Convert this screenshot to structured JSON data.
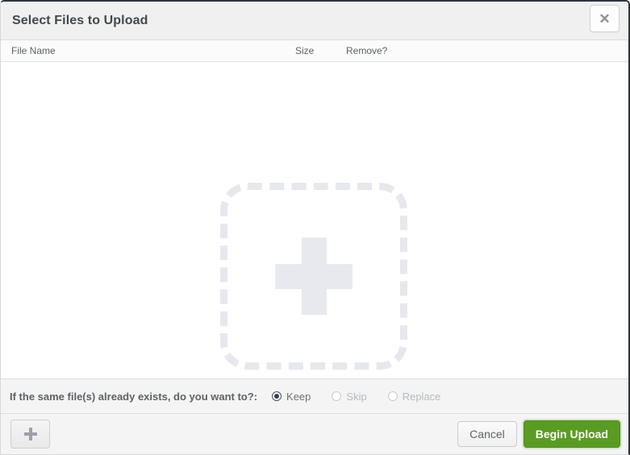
{
  "dialog": {
    "title": "Select Files to Upload",
    "close_icon": "close-icon",
    "close_glyph": "✕"
  },
  "table": {
    "columns": [
      "File Name",
      "Size",
      "Remove?"
    ],
    "rows": []
  },
  "dropzone": {
    "icon": "plus-icon",
    "hint": ""
  },
  "options": {
    "label": "If the same file(s) already exists, do you want to?:",
    "choices": [
      {
        "label": "Keep",
        "selected": true
      },
      {
        "label": "Skip",
        "selected": false
      },
      {
        "label": "Replace",
        "selected": false
      }
    ]
  },
  "footer": {
    "add_icon": "plus-icon",
    "cancel_label": "Cancel",
    "upload_label": "Begin Upload"
  },
  "colors": {
    "titlebar_bg": "#f0f0f0",
    "title_text": "#41484f",
    "dropzone_gray": "#e6e8ed",
    "upload_green": "#5a9c23",
    "radio_selected": "#2f3f55",
    "muted_text": "#b6babf"
  }
}
